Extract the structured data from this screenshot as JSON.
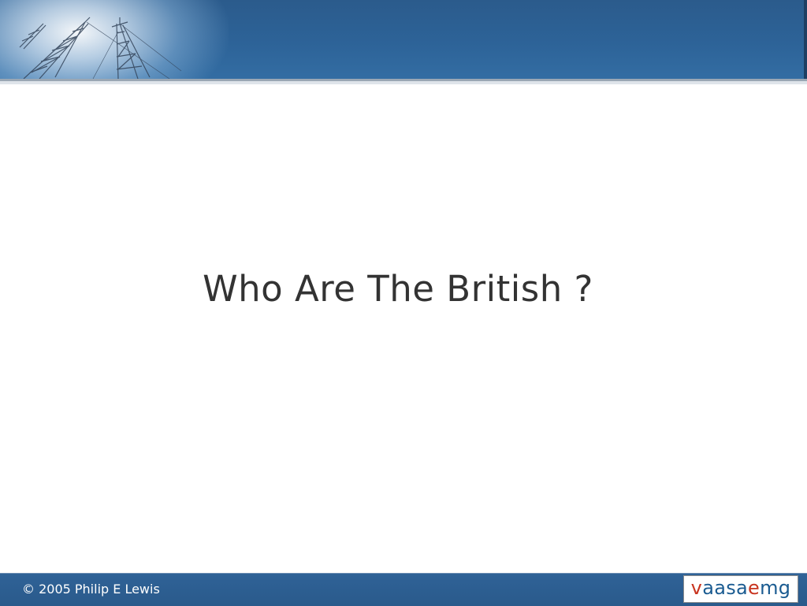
{
  "slide": {
    "title": "Who Are The British ?"
  },
  "footer": {
    "copyright": "© 2005 Philip E Lewis",
    "logo": {
      "text": "vaasaemg",
      "parts": [
        "v",
        "aasa",
        "e",
        "mg"
      ],
      "colors": {
        "accent": "#c8341f",
        "primary": "#1a5b91"
      }
    }
  },
  "theme": {
    "header_color": "#2d6398",
    "footer_color": "#2a5a8b",
    "title_color": "#333333"
  },
  "header": {
    "image": "radio-mast-towers-sky"
  }
}
